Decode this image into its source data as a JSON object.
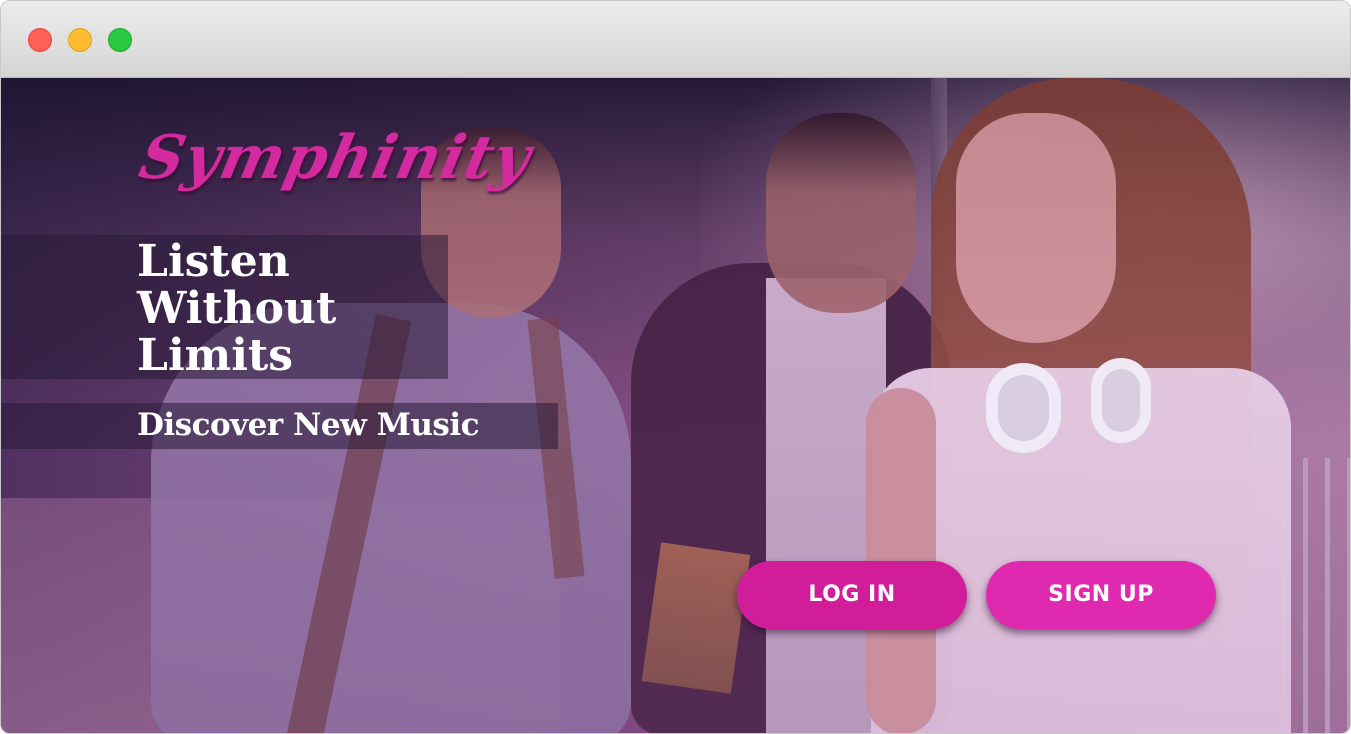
{
  "window": {
    "controls": [
      "close",
      "minimize",
      "zoom"
    ]
  },
  "brand": {
    "logo_text": "Symphinity",
    "accent_color": "#d11d9a"
  },
  "hero": {
    "headline_lines": [
      "Listen",
      "Without",
      "Limits"
    ],
    "subheadline": "Discover New Music"
  },
  "actions": {
    "login_label": "LOG IN",
    "signup_label": "SIGN UP"
  }
}
